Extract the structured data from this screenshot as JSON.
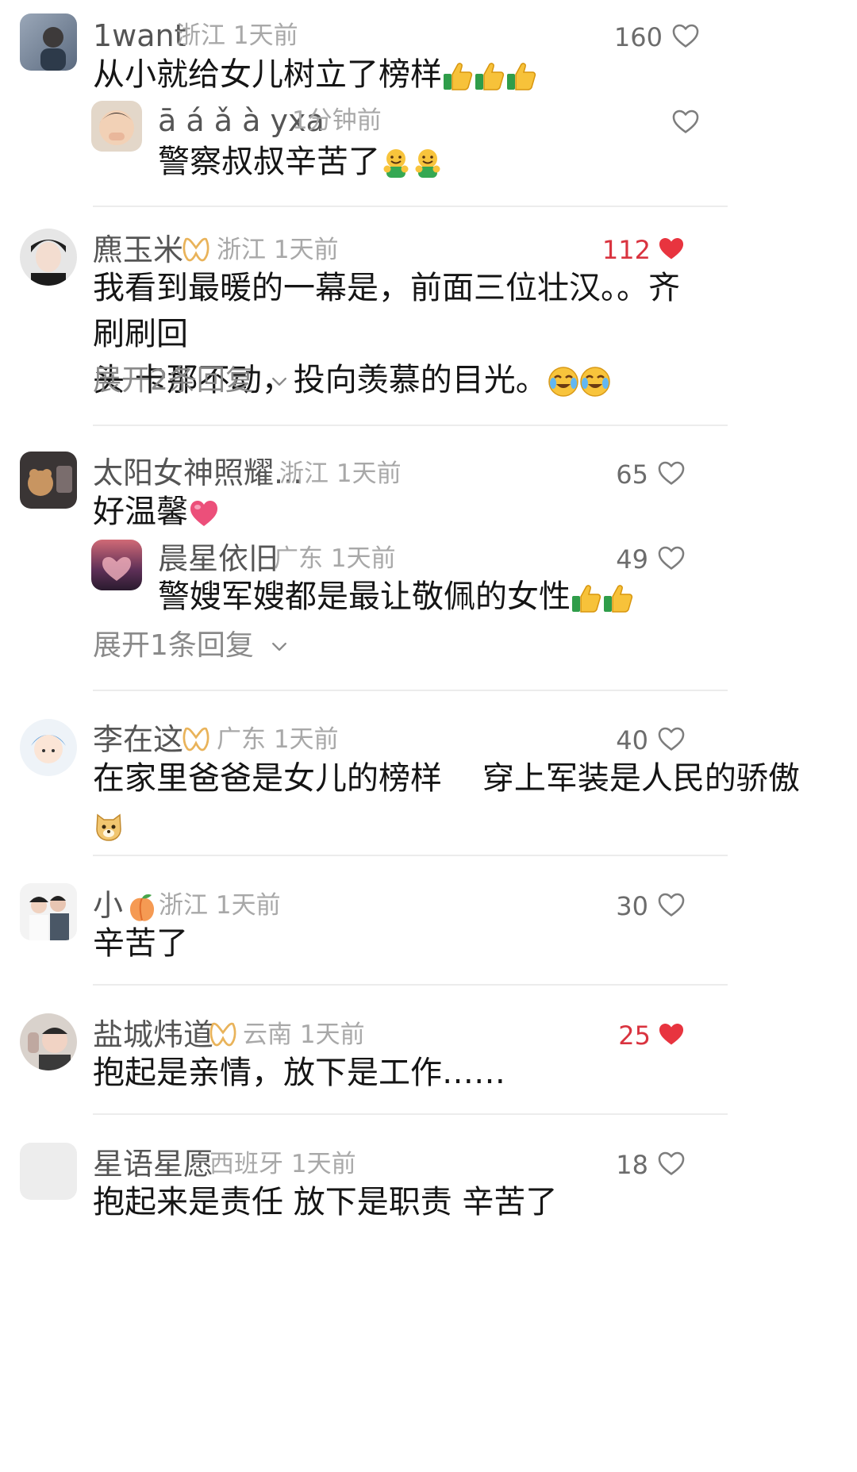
{
  "comments": [
    {
      "name": "1want",
      "region": "浙江",
      "time": "1天前",
      "likes": "160",
      "liked": false,
      "text": "从小就给女儿树立了榜样",
      "reply": {
        "name": "ā á ǎ à yxa",
        "time": "1分钟前",
        "text": "警察叔叔辛苦了"
      }
    },
    {
      "name": "麃玉米",
      "region": "浙江",
      "time": "1天前",
      "likes": "112",
      "liked": true,
      "text_line1": "我看到最暖的一幕是，前面三位壮汉。。齐刷刷回",
      "text_line2": "头  卡那不动，投向羡慕的目光。",
      "expand": "展开2条回复"
    },
    {
      "name": "太阳女神照耀...",
      "region": "浙江",
      "time": "1天前",
      "likes": "65",
      "liked": false,
      "text": "好温馨",
      "reply": {
        "name": "晨星依旧",
        "region": "广东",
        "time": "1天前",
        "likes": "49",
        "text": "警嫂军嫂都是最让敬佩的女性"
      },
      "expand": "展开1条回复"
    },
    {
      "name": "李在这",
      "region": "广东",
      "time": "1天前",
      "likes": "40",
      "liked": false,
      "text": "在家里爸爸是女儿的榜样    穿上军装是人民的骄傲"
    },
    {
      "name": "小",
      "region": "浙江",
      "time": "1天前",
      "likes": "30",
      "liked": false,
      "text": "辛苦了"
    },
    {
      "name": "盐城炜道",
      "region": "云南",
      "time": "1天前",
      "likes": "25",
      "liked": true,
      "text": "抱起是亲情，放下是工作……"
    },
    {
      "name": "星语星愿",
      "region": "西班牙",
      "time": "1天前",
      "likes": "18",
      "liked": false,
      "text": "抱起来是责任 放下是职责 辛苦了"
    }
  ],
  "colors": {
    "liked": "#e8343f",
    "accent_badge": "#e9b35a"
  },
  "icons": [
    "heart-outline-icon",
    "heart-filled-icon",
    "chevron-down-icon",
    "badge-icon",
    "thumbs-up-emoji",
    "crying-laugh-emoji",
    "peach-emoji",
    "doge-emoji",
    "heart-emoji",
    "hug-emoji"
  ]
}
